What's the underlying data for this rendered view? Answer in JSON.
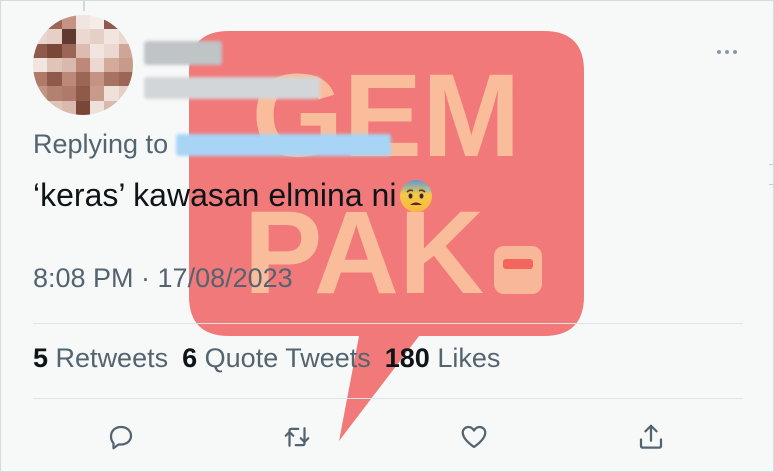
{
  "watermark": {
    "line1": "GEM",
    "line2": "PAK"
  },
  "tweet": {
    "replying_label": "Replying to",
    "text": "‘keras’ kawasan elmina ni",
    "emoji": "anxious-face-with-sweat",
    "timestamp": "8:08 PM · 17/08/2023"
  },
  "stats": {
    "retweets_count": "5",
    "retweets_label": "Retweets",
    "quotes_count": "6",
    "quotes_label": "Quote Tweets",
    "likes_count": "180",
    "likes_label": "Likes"
  },
  "actions": {
    "icons": [
      "reply-icon",
      "retweet-icon",
      "like-icon",
      "share-icon"
    ]
  },
  "colors": {
    "secondary_text": "#536471",
    "primary_text": "#0f1419",
    "watermark_red": "#e8403d",
    "mention_blue": "#1d9bf0"
  }
}
